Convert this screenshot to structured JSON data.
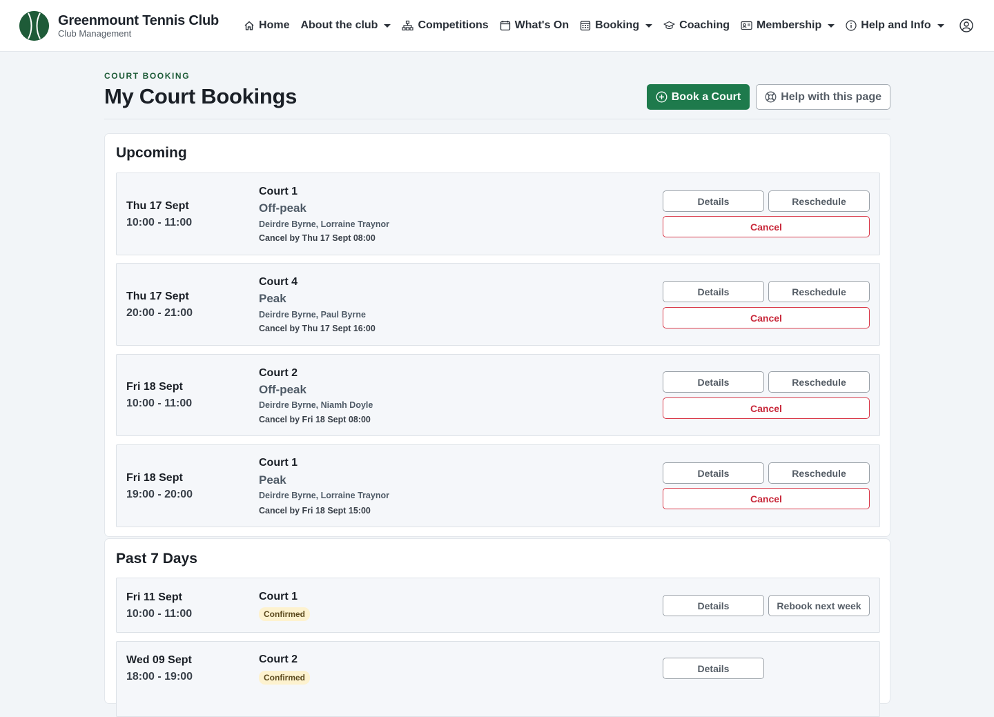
{
  "brand": {
    "title": "Greenmount Tennis Club",
    "subtitle": "Club Management"
  },
  "nav": {
    "home": "Home",
    "about": "About the club",
    "competitions": "Competitions",
    "whats_on": "What's On",
    "booking": "Booking",
    "coaching": "Coaching",
    "membership": "Membership",
    "help": "Help and Info"
  },
  "page": {
    "crumb": "COURT BOOKING",
    "title": "My Court Bookings",
    "book_button": "Book a Court",
    "help_button": "Help with this page"
  },
  "upcoming": {
    "title": "Upcoming",
    "bookings": [
      {
        "date": "Thu 17 Sept",
        "time": "10:00 - 11:00",
        "court": "Court 1",
        "rate": "Off-peak",
        "players": "Deirdre Byrne, Lorraine Traynor",
        "cancel_by": "Cancel by Thu 17 Sept 08:00",
        "details": "Details",
        "reschedule": "Reschedule",
        "cancel": "Cancel"
      },
      {
        "date": "Thu 17 Sept",
        "time": "20:00 - 21:00",
        "court": "Court 4",
        "rate": "Peak",
        "players": "Deirdre Byrne, Paul Byrne",
        "cancel_by": "Cancel by Thu 17 Sept 16:00",
        "details": "Details",
        "reschedule": "Reschedule",
        "cancel": "Cancel"
      },
      {
        "date": "Fri 18 Sept",
        "time": "10:00 - 11:00",
        "court": "Court 2",
        "rate": "Off-peak",
        "players": "Deirdre Byrne, Niamh Doyle",
        "cancel_by": "Cancel by Fri 18 Sept 08:00",
        "details": "Details",
        "reschedule": "Reschedule",
        "cancel": "Cancel"
      },
      {
        "date": "Fri 18 Sept",
        "time": "19:00 - 20:00",
        "court": "Court 1",
        "rate": "Peak",
        "players": "Deirdre Byrne, Lorraine Traynor",
        "cancel_by": "Cancel by Fri 18 Sept 15:00",
        "details": "Details",
        "reschedule": "Reschedule",
        "cancel": "Cancel"
      }
    ]
  },
  "past": {
    "title": "Past 7 Days",
    "bookings": [
      {
        "date": "Fri 11 Sept",
        "time": "10:00 - 11:00",
        "court": "Court 1",
        "status": "Confirmed",
        "details": "Details",
        "rebook": "Rebook next week"
      },
      {
        "date": "Wed 09 Sept",
        "time": "18:00 - 19:00",
        "court": "Court 2",
        "status": "Confirmed",
        "details": "Details"
      }
    ]
  },
  "colors": {
    "brand_green": "#1e5b38",
    "primary_button": "#1e7a4c",
    "danger": "#c8283a",
    "badge_bg": "#fdf2cf"
  }
}
